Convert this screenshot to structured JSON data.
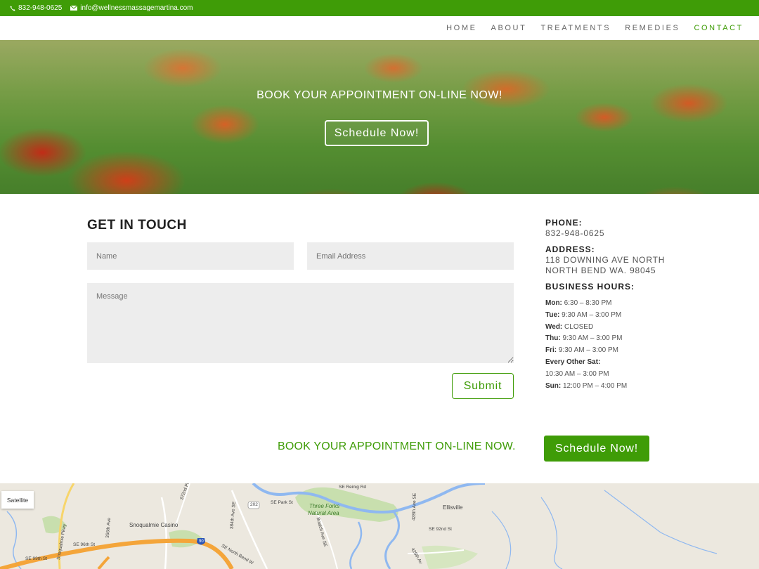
{
  "topbar": {
    "phone": "832-948-0625",
    "email": "info@wellnessmassagemartina.com"
  },
  "nav": {
    "items": [
      "HOME",
      "ABOUT",
      "TREATMENTS",
      "REMEDIES",
      "CONTACT"
    ],
    "active": "CONTACT"
  },
  "hero": {
    "title": "BOOK YOUR APPOINTMENT ON-LINE NOW!",
    "button": "Schedule Now!"
  },
  "form": {
    "title": "GET IN TOUCH",
    "name_placeholder": "Name",
    "email_placeholder": "Email Address",
    "message_placeholder": "Message",
    "submit": "Submit"
  },
  "contact": {
    "phone_label": "PHONE:",
    "phone": "832-948-0625",
    "address_label": "ADDRESS:",
    "address_line1": "118 DOWNING AVE NORTH",
    "address_line2": "NORTH BEND WA. 98045",
    "hours_label": "BUSINESS HOURS:",
    "hours": [
      {
        "day": "Mon:",
        "time": "6:30 – 8:30 PM"
      },
      {
        "day": "Tue:",
        "time": "9:30 AM – 3:00 PM"
      },
      {
        "day": "Wed:",
        "time": "CLOSED"
      },
      {
        "day": "Thu:",
        "time": "9:30 AM – 3:00 PM"
      },
      {
        "day": "Fri:",
        "time": "9:30 AM – 3:00 PM"
      },
      {
        "day": "Every Other Sat:",
        "time": ""
      },
      {
        "day": "",
        "time": "10:30 AM – 3:00 PM"
      },
      {
        "day": "Sun:",
        "time": "12:00 PM – 4:00 PM"
      }
    ]
  },
  "cta": {
    "text": "BOOK YOUR APPOINTMENT ON-LINE NOW.",
    "button": "Schedule Now!"
  },
  "map": {
    "satellite_button": "Satellite",
    "labels": {
      "three_forks": "Three Forks",
      "natural_area": "Natural Area",
      "ellisville": "Ellisville",
      "casino": "Snoqualmie Casino",
      "park_st": "SE Park St",
      "reinig": "SE Reinig Rd",
      "ave372": "372nd Pl",
      "ave384": "384th Ave SE",
      "ave356": "356th Ave",
      "snoq_pkwy": "Snoqualmie Pkwy",
      "se96": "SE 96th St",
      "se99": "SE 99th St",
      "se92": "SE 92nd St",
      "ave428": "428th Ave SE",
      "nb_way": "SE North Bend W",
      "boalch": "Boalch Ave SE",
      "ave429": "429th Av",
      "route202": "202",
      "i90": "90"
    },
    "colors": {
      "water": "#8fb8f0",
      "park": "#c8dfae",
      "highway": "#f4a53a",
      "land": "#ece8df"
    }
  }
}
